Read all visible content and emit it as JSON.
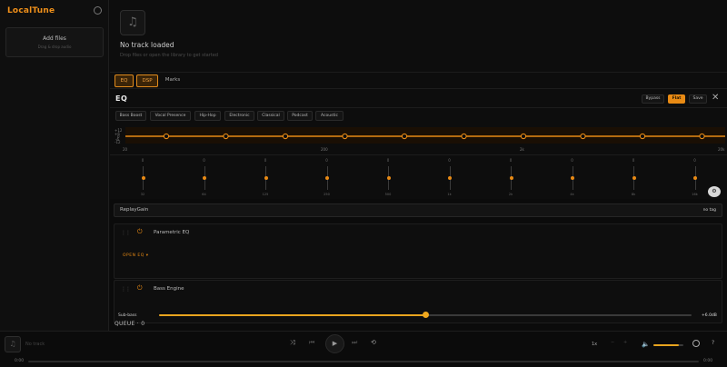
{
  "app": {
    "logo": "LocalTune",
    "github_icon": "github-icon"
  },
  "sidebar": {
    "add_files_title": "Add files",
    "add_files_hint": "Drag & drop audio"
  },
  "now_playing": {
    "art_icon": "music-note-icon",
    "title": "No track loaded",
    "subtitle": "Drop files or open the library to get started"
  },
  "tabs": [
    {
      "label": "EQ",
      "active": true
    },
    {
      "label": "DSP",
      "active": true
    },
    {
      "label": "Marks",
      "active": false
    }
  ],
  "eq": {
    "title": "EQ",
    "bypass_label": "Bypass",
    "flat_label": "Flat",
    "save_label": "Save",
    "close_icon": "close-icon",
    "presets": [
      "Bass Boost",
      "Vocal Presence",
      "Hip-Hop",
      "Electronic",
      "Classical",
      "Podcast",
      "Acoustic"
    ],
    "curve_ticks": [
      "+12",
      "+6",
      "0",
      "-6",
      "-12"
    ],
    "curve_freq_labels": [
      "20",
      "200",
      "2k",
      "20k"
    ],
    "accent": "#e88a14",
    "bands": [
      {
        "freq": "32",
        "gain": "0"
      },
      {
        "freq": "64",
        "gain": "0"
      },
      {
        "freq": "125",
        "gain": "0"
      },
      {
        "freq": "250",
        "gain": "0"
      },
      {
        "freq": "500",
        "gain": "0"
      },
      {
        "freq": "1k",
        "gain": "0"
      },
      {
        "freq": "2k",
        "gain": "0"
      },
      {
        "freq": "4k",
        "gain": "0"
      },
      {
        "freq": "8k",
        "gain": "0"
      },
      {
        "freq": "16k",
        "gain": "0"
      }
    ],
    "reset_icon": "sliders-reset-icon"
  },
  "dsp": {
    "replaygain_label": "ReplayGain",
    "replaygain_toggle": "no tag",
    "modules": [
      {
        "name": "Parametric EQ",
        "action": "OPEN EQ ▾"
      },
      {
        "name": "Bass Engine"
      }
    ],
    "subbass": {
      "label": "Sub-bass",
      "value": "+6.0dB",
      "fraction": 0.5
    }
  },
  "queue": {
    "label": "QUEUE · 0"
  },
  "player": {
    "track_info": "No track",
    "time_current": "0:00",
    "time_total": "0:00",
    "speed": "1x",
    "volume_fraction": 0.85,
    "help": "?"
  }
}
